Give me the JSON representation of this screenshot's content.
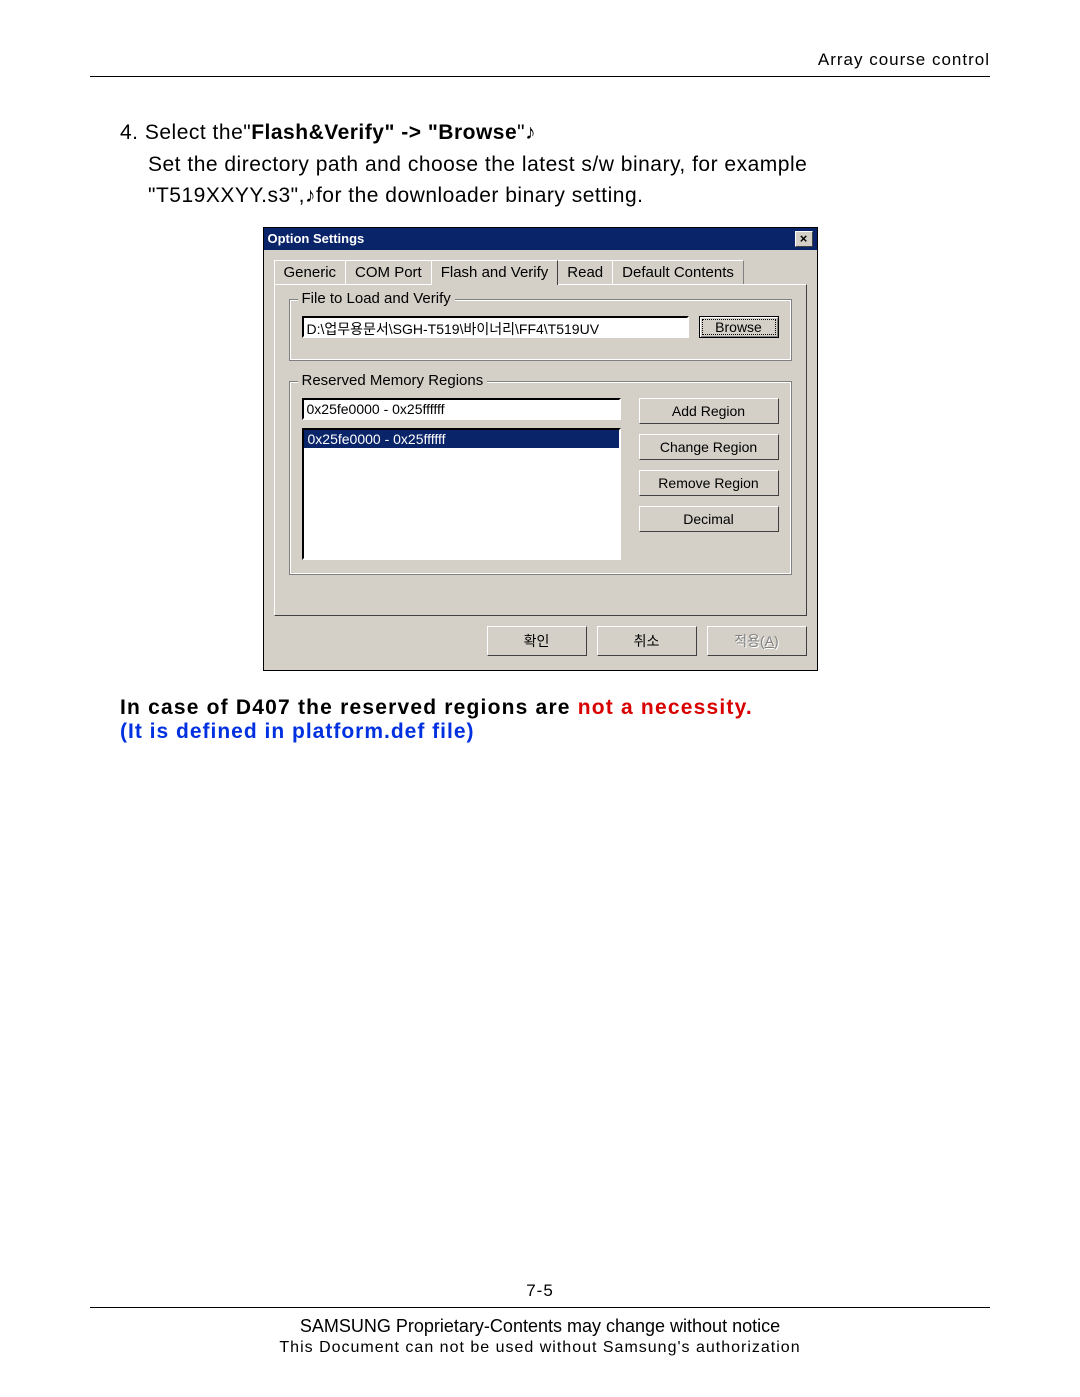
{
  "header": {
    "right": "Array course control"
  },
  "instruction": {
    "number": "4.",
    "prefix": "Select the\"",
    "bold1": "Flash&Verify\" -> \"Browse",
    "suffix1": "\"♪",
    "line2a": "Set the directory path and choose the latest s/w binary, for example",
    "line2b": "\"T519XXYY.s3\",♪for the downloader binary setting."
  },
  "dialog": {
    "title": "Option Settings",
    "close_glyph": "×",
    "tabs": [
      "Generic",
      "COM Port",
      "Flash and Verify",
      "Read",
      "Default Contents"
    ],
    "active_tab_index": 2,
    "group1": {
      "legend": "File to Load and Verify",
      "path": "D:\\업무용문서\\SGH-T519\\바이너리\\FF4\\T519UV",
      "browse": "Browse"
    },
    "group2": {
      "legend": "Reserved Memory Regions",
      "input_value": "0x25fe0000 - 0x25ffffff",
      "list": [
        "0x25fe0000 - 0x25ffffff"
      ],
      "buttons": {
        "add": "Add Region",
        "change": "Change Region",
        "remove": "Remove Region",
        "decimal": "Decimal"
      }
    },
    "footer_buttons": {
      "ok": "확인",
      "cancel": "취소",
      "apply_pre": "적용(",
      "apply_u": "A",
      "apply_post": ")"
    }
  },
  "note": {
    "black": "In case of D407 the reserved regions are ",
    "red": "not a necessity.",
    "blue": "(It is defined in platform.def file)"
  },
  "footer": {
    "page": "7-5",
    "line1": "SAMSUNG Proprietary-Contents may change without notice",
    "line2": "This Document can not be used without Samsung's authorization"
  }
}
